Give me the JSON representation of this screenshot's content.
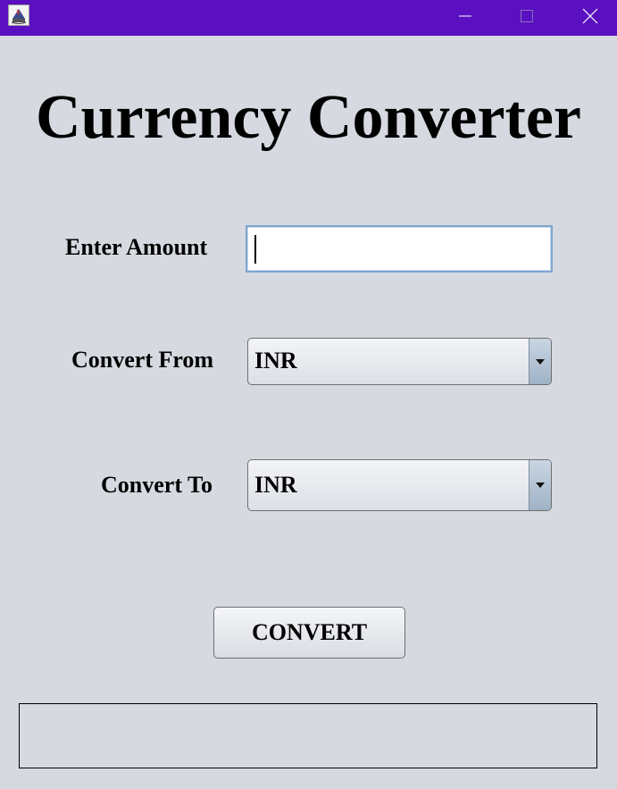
{
  "window": {
    "icon": "java-cup-icon",
    "controls": {
      "minimize_icon": "minimize-icon",
      "maximize_icon": "maximize-icon",
      "close_icon": "close-icon"
    },
    "titlebar_color": "#5a10c0"
  },
  "main": {
    "title": "Currency Converter",
    "amount": {
      "label": "Enter Amount",
      "value": ""
    },
    "convert_from": {
      "label": "Convert From",
      "selected": "INR"
    },
    "convert_to": {
      "label": "Convert To",
      "selected": "INR"
    },
    "convert_button": "CONVERT",
    "result": ""
  }
}
